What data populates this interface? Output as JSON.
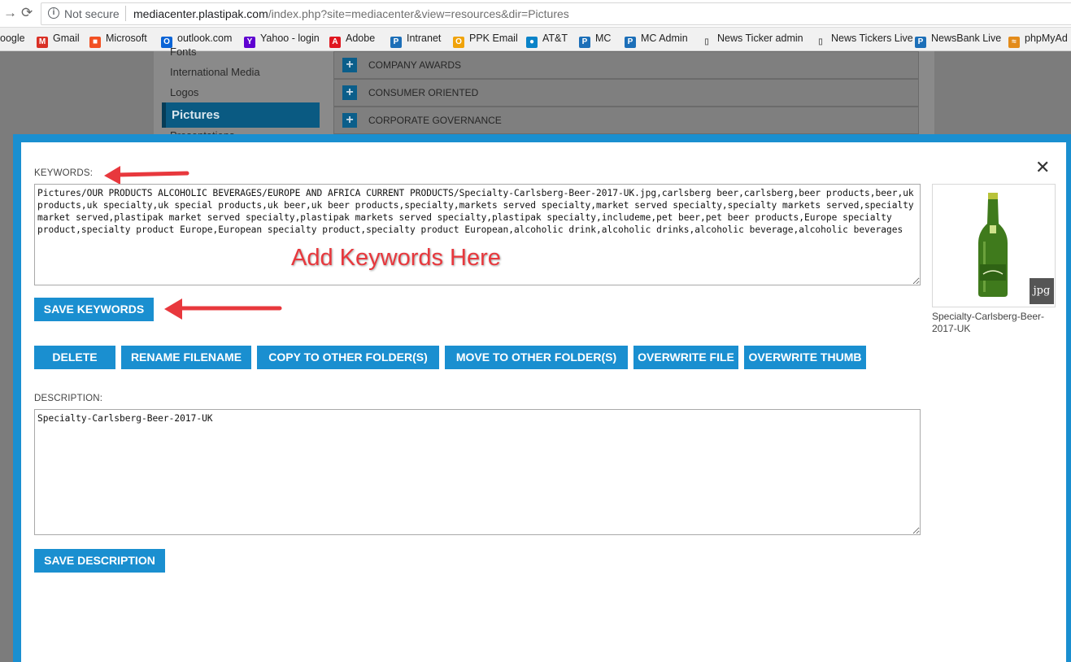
{
  "browser": {
    "security_label": "Not secure",
    "url_host": "mediacenter.plastipak.com",
    "url_path": "/index.php?site=mediacenter&view=resources&dir=Pictures",
    "bookmarks": [
      {
        "label": "oogle",
        "icon": "google-icon",
        "color": "#4285f4"
      },
      {
        "label": "Gmail",
        "icon": "gmail-icon",
        "color": "#d93025"
      },
      {
        "label": "Microsoft",
        "icon": "microsoft-icon",
        "color": "#f25022"
      },
      {
        "label": "outlook.com",
        "icon": "outlook-icon",
        "color": "#0a64d6"
      },
      {
        "label": "Yahoo - login",
        "icon": "yahoo-icon",
        "color": "#5f01d1"
      },
      {
        "label": "Adobe",
        "icon": "adobe-icon",
        "color": "#e0171f"
      },
      {
        "label": "Intranet",
        "icon": "intranet-icon",
        "color": "#1c6fb8"
      },
      {
        "label": "PPK Email",
        "icon": "ppk-email-icon",
        "color": "#f0a30a"
      },
      {
        "label": "AT&T",
        "icon": "att-icon",
        "color": "#0a83c8"
      },
      {
        "label": "MC",
        "icon": "mc-icon",
        "color": "#1c6fb8"
      },
      {
        "label": "MC Admin",
        "icon": "mc-admin-icon",
        "color": "#1c6fb8"
      },
      {
        "label": "News Ticker admin",
        "icon": "page-icon",
        "color": "#888888"
      },
      {
        "label": "News Tickers Live",
        "icon": "page-icon",
        "color": "#888888"
      },
      {
        "label": "NewsBank Live",
        "icon": "newsbank-icon",
        "color": "#1c6fb8"
      },
      {
        "label": "phpMyAd",
        "icon": "phpmyadmin-icon",
        "color": "#e38b1a"
      }
    ]
  },
  "sidebar": {
    "items": [
      "Fonts",
      "International Media",
      "Logos"
    ],
    "active": "Pictures",
    "partial": "Presentations"
  },
  "accordion": {
    "rows": [
      "COMPANY AWARDS",
      "CONSUMER ORIENTED",
      "CORPORATE GOVERNANCE"
    ]
  },
  "modal": {
    "keywords_label": "KEYWORDS:",
    "keywords_value": "Pictures/OUR PRODUCTS ALCOHOLIC BEVERAGES/EUROPE AND AFRICA CURRENT PRODUCTS/Specialty-Carlsberg-Beer-2017-UK.jpg,carlsberg beer,carlsberg,beer products,beer,uk products,uk specialty,uk special products,uk beer,uk beer products,specialty,markets served specialty,market served specialty,specialty markets served,specialty market served,plastipak market served specialty,plastipak markets served specialty,plastipak specialty,includeme,pet beer,pet beer products,Europe specialty product,specialty product Europe,European specialty product,specialty product European,alcoholic drink,alcoholic drinks,alcoholic beverage,alcoholic beverages",
    "annotation": "Add Keywords Here",
    "save_keywords": "SAVE KEYWORDS",
    "actions": {
      "delete": "DELETE",
      "rename": "RENAME FILENAME",
      "copy": "COPY TO OTHER FOLDER(S)",
      "move": "MOVE TO OTHER FOLDER(S)",
      "overwrite_file": "OVERWRITE FILE",
      "overwrite_thumb": "OVERWRITE THUMB"
    },
    "description_label": "DESCRIPTION:",
    "description_value": "Specialty-Carlsberg-Beer-2017-UK",
    "save_description": "SAVE DESCRIPTION",
    "thumb_badge": "jpg",
    "thumb_caption": "Specialty-Carlsberg-Beer-2017-UK",
    "close_glyph": "✕"
  },
  "colors": {
    "accent": "#1a8fd0",
    "arrow": "#e8383d"
  }
}
